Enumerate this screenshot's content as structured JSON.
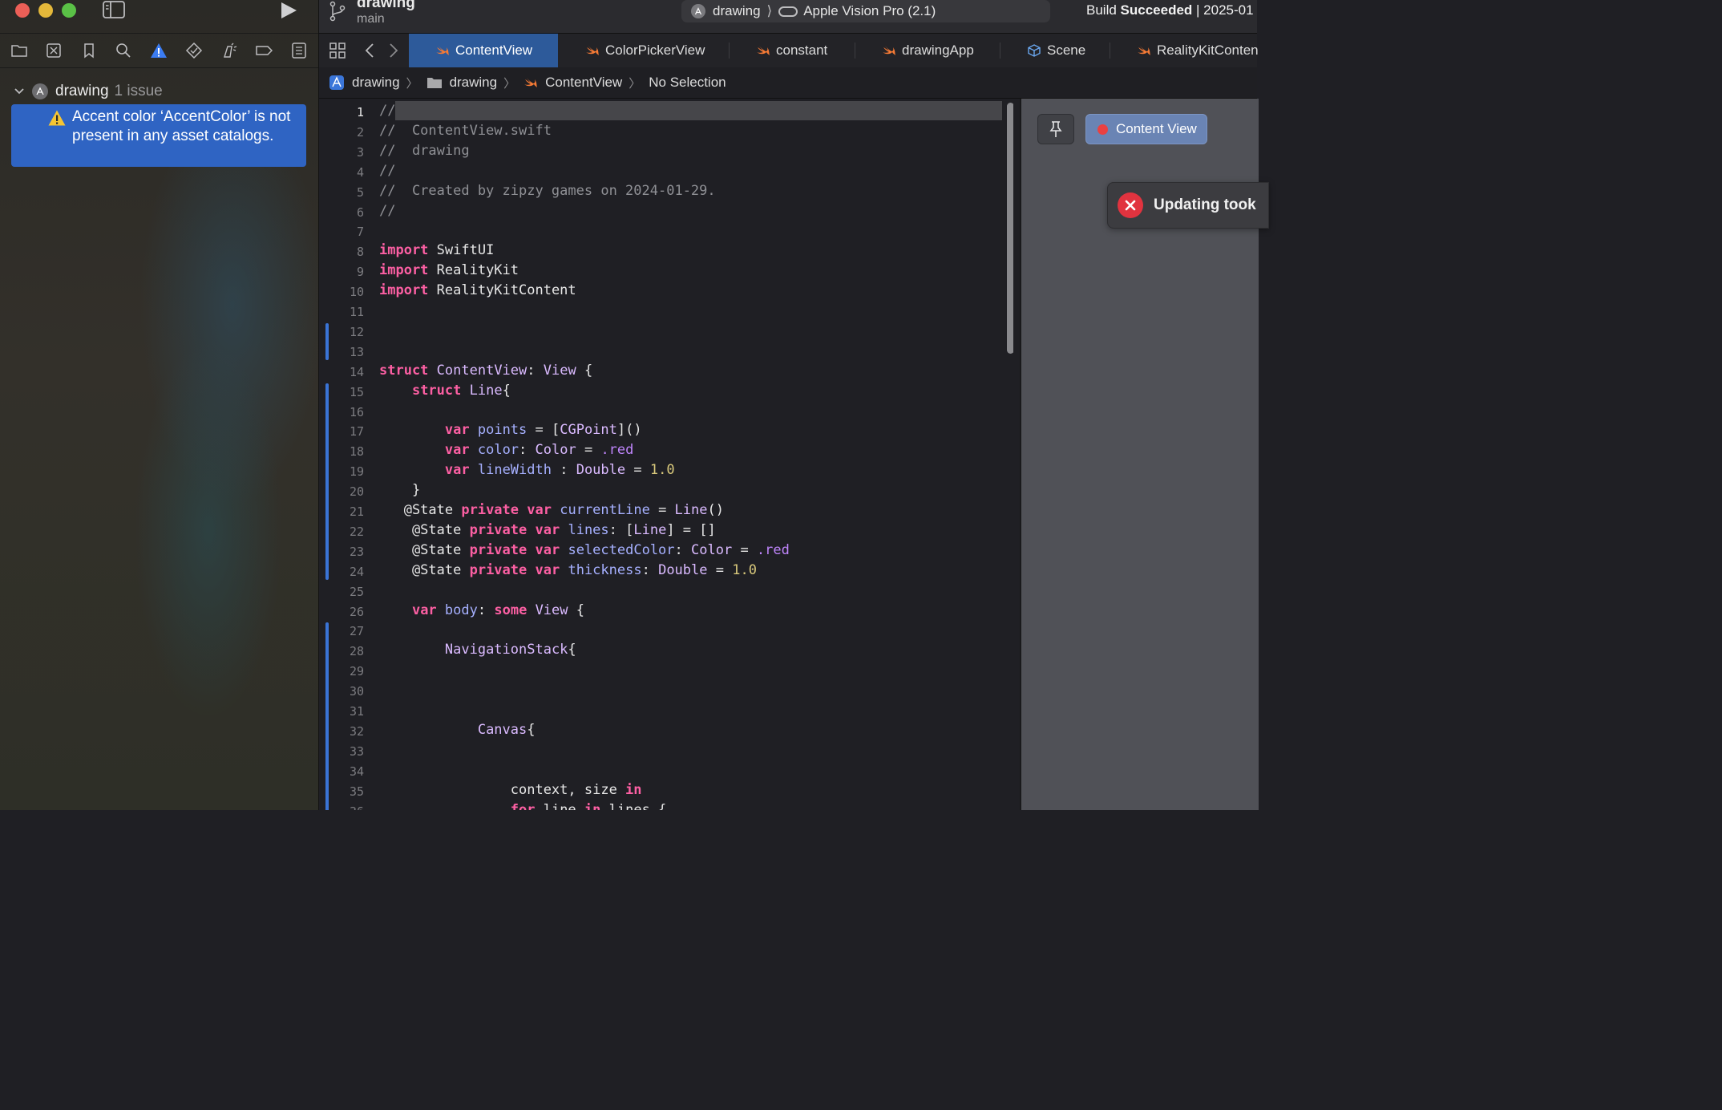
{
  "window": {
    "project": "drawing",
    "branch": "main",
    "scheme": "drawing",
    "scheme_separator": "⟩",
    "device": "Apple Vision Pro (2.1)",
    "build_prefix": "Build ",
    "build_status": "Succeeded",
    "build_suffix": " | 2025-01"
  },
  "navigator": {
    "project_name": "drawing",
    "issue_count": "1 issue",
    "issues": [
      {
        "severity": "warning",
        "message": "Accent color ‘AccentColor’ is not present in any asset catalogs."
      }
    ],
    "toolbar_icons": [
      "folder-icon",
      "source-control-icon",
      "bookmark-icon",
      "find-icon",
      "issue-warning-icon",
      "test-icon",
      "debug-icon",
      "breakpoint-icon",
      "report-icon"
    ]
  },
  "tabs": [
    {
      "label": "ContentView",
      "icon": "swift-icon",
      "active": true
    },
    {
      "label": "ColorPickerView",
      "icon": "swift-icon",
      "active": false
    },
    {
      "label": "constant",
      "icon": "swift-icon",
      "active": false
    },
    {
      "label": "drawingApp",
      "icon": "swift-icon",
      "active": false
    },
    {
      "label": "Scene",
      "icon": "reality-scene-icon",
      "active": false
    },
    {
      "label": "RealityKitConten",
      "icon": "swift-icon",
      "active": false
    }
  ],
  "jumpbar": [
    "drawing",
    "drawing",
    "ContentView",
    "No Selection"
  ],
  "editor": {
    "current_line": 1,
    "line_numbers": [
      "1",
      "2",
      "3",
      "4",
      "5",
      "6",
      "7",
      "8",
      "9",
      "10",
      "11",
      "12",
      "13",
      "14",
      "15",
      "16",
      "17",
      "18",
      "19",
      "20",
      "21",
      "22",
      "23",
      "24",
      "25",
      "26",
      "27",
      "28",
      "29",
      "30",
      "31",
      "32",
      "33",
      "34",
      "35",
      "36"
    ],
    "lines": [
      "//",
      "//  ContentView.swift",
      "//  drawing",
      "//",
      "//  Created by zipzy games on 2024-01-29.",
      "//",
      "",
      "import SwiftUI",
      "import RealityKit",
      "import RealityKitContent",
      "",
      "",
      "",
      "struct ContentView: View {",
      "    struct Line{",
      "",
      "        var points = [CGPoint]()",
      "        var color: Color = .red",
      "        var lineWidth : Double = 1.0",
      "    }",
      "   @State private var currentLine = Line()",
      "    @State private var lines: [Line] = []",
      "    @State private var selectedColor: Color = .red",
      "    @State private var thickness: Double = 1.0",
      "",
      "    var body: some View {",
      "",
      "        NavigationStack{",
      "",
      "",
      "",
      "            Canvas{",
      "",
      "",
      "                context, size in",
      "                for line in lines {"
    ]
  },
  "preview": {
    "pin_label": "pin-icon",
    "content_view_label": "Content View",
    "error_text": "Updating took"
  },
  "colors": {
    "accent": "#2f64c3",
    "keyword": "#fc5fa3",
    "comment": "#8f9095",
    "number": "#d9c97c",
    "error": "#e1333f"
  }
}
